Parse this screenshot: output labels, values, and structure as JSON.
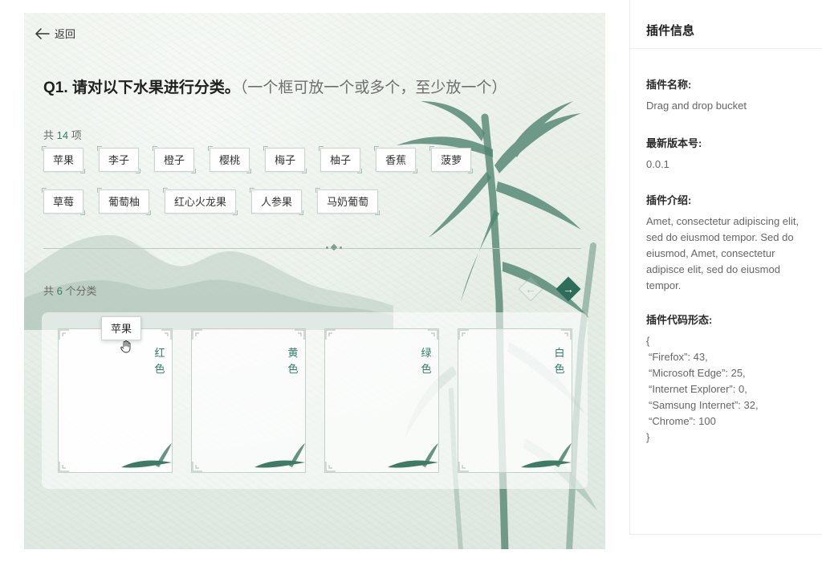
{
  "stage": {
    "back_label": "返回",
    "question": {
      "number_text": "Q1. 请对以下水果进行分类。",
      "hint": "（一个框可放一个或多个，至少放一个）"
    },
    "items_count": {
      "prefix": "共",
      "count": "14",
      "suffix": "项"
    },
    "items_row1": [
      "苹果",
      "李子",
      "橙子",
      "樱桃",
      "梅子",
      "柚子",
      "香蕉",
      "菠萝"
    ],
    "items_row2": [
      "草莓",
      "葡萄柚",
      "红心火龙果",
      "人参果",
      "马奶葡萄"
    ],
    "categories_count": {
      "prefix": "共",
      "count": "6",
      "suffix": "个分类"
    },
    "buckets": [
      "红色",
      "黄色",
      "绿色",
      "白色"
    ],
    "dragging_item": "苹果",
    "accent_color": "#2f7d68"
  },
  "sidebar": {
    "title": "插件信息",
    "name_label": "插件名称:",
    "name_value": "Drag and drop bucket",
    "version_label": "最新版本号:",
    "version_value": "0.0.1",
    "intro_label": "插件介绍:",
    "intro_value": "Amet, consectetur adipiscing elit, sed do eiusmod tempor. Sed do eiusmod, Amet, consectetur adipisce elit, sed do eiusmod tempor.",
    "code_label": "插件代码形态:",
    "code_lines": [
      "{",
      "“Firefox”: 43,",
      "“Microsoft Edge”: 25,",
      "“Internet Explorer”: 0,",
      "“Samsung Internet”: 32,",
      "“Chrome”: 100",
      "}"
    ]
  }
}
